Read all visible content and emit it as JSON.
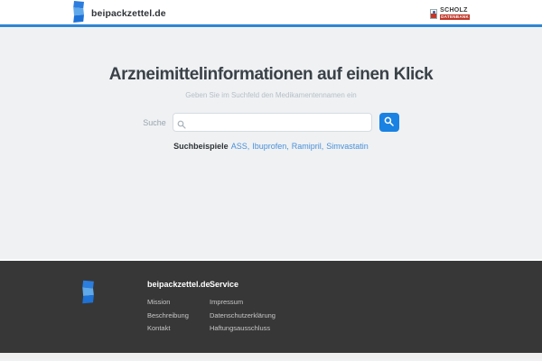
{
  "colors": {
    "accent_blue": "#1a82e2",
    "header_border_blue": "#2e86d5",
    "link_blue": "#4a90d9",
    "footer_background": "#373737",
    "page_background": "#eff1f3",
    "partner_red": "#c0392b"
  },
  "header": {
    "site_name": "beipackzettel.de",
    "partner": {
      "name": "SCHOLZ",
      "sub": "DATENBANK"
    }
  },
  "hero": {
    "title": "Arzneimittelinformationen auf einen Klick",
    "subtitle": "Geben Sie im Suchfeld den Medikamentennamen ein",
    "search_label": "Suche",
    "search_value": "",
    "examples_label": "Suchbeispiele",
    "separator": ",",
    "examples": [
      "ASS",
      "Ibuprofen",
      "Ramipril",
      "Simvastatin"
    ]
  },
  "footer": {
    "brand_heading": "beipackzettel.de",
    "brand_links": [
      "Mission",
      "Beschreibung",
      "Kontakt"
    ],
    "service_heading": "Service",
    "service_links": [
      "Impressum",
      "Datenschutzerklärung",
      "Haftungsausschluss"
    ]
  }
}
